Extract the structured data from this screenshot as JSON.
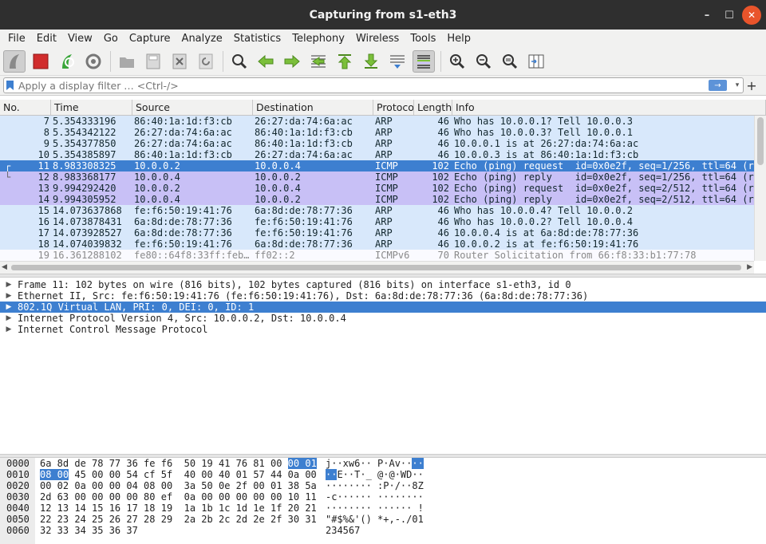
{
  "window": {
    "title": "Capturing from s1-eth3",
    "minimize": "–",
    "maximize": "☐",
    "close": "✕"
  },
  "menu": [
    "File",
    "Edit",
    "View",
    "Go",
    "Capture",
    "Analyze",
    "Statistics",
    "Telephony",
    "Wireless",
    "Tools",
    "Help"
  ],
  "filter": {
    "placeholder": "Apply a display filter … <Ctrl-/>",
    "apply_icon": "→",
    "dropdown_icon": "▾",
    "add_icon": "+"
  },
  "columns": [
    "No.",
    "Time",
    "Source",
    "Destination",
    "Protocol",
    "Length",
    "Info"
  ],
  "packets": [
    {
      "no": "7",
      "time": "5.354333196",
      "src": "86:40:1a:1d:f3:cb",
      "dst": "26:27:da:74:6a:ac",
      "proto": "ARP",
      "len": "46",
      "info": "Who has 10.0.0.1? Tell 10.0.0.3",
      "bg": "#d8e8fb",
      "fg": "#12272e"
    },
    {
      "no": "8",
      "time": "5.354342122",
      "src": "26:27:da:74:6a:ac",
      "dst": "86:40:1a:1d:f3:cb",
      "proto": "ARP",
      "len": "46",
      "info": "Who has 10.0.0.3? Tell 10.0.0.1",
      "bg": "#d8e8fb",
      "fg": "#12272e"
    },
    {
      "no": "9",
      "time": "5.354377850",
      "src": "26:27:da:74:6a:ac",
      "dst": "86:40:1a:1d:f3:cb",
      "proto": "ARP",
      "len": "46",
      "info": "10.0.0.1 is at 26:27:da:74:6a:ac",
      "bg": "#d8e8fb",
      "fg": "#12272e"
    },
    {
      "no": "10",
      "time": "5.354385897",
      "src": "86:40:1a:1d:f3:cb",
      "dst": "26:27:da:74:6a:ac",
      "proto": "ARP",
      "len": "46",
      "info": "10.0.0.3 is at 86:40:1a:1d:f3:cb",
      "bg": "#d8e8fb",
      "fg": "#12272e"
    },
    {
      "no": "11",
      "time": "8.983308325",
      "src": "10.0.0.2",
      "dst": "10.0.0.4",
      "proto": "ICMP",
      "len": "102",
      "info": "Echo (ping) request  id=0x0e2f, seq=1/256, ttl=64 (r",
      "bg": "#3d7fd0",
      "fg": "#ffffff",
      "selected": true,
      "mark": "┌"
    },
    {
      "no": "12",
      "time": "8.983368177",
      "src": "10.0.0.4",
      "dst": "10.0.0.2",
      "proto": "ICMP",
      "len": "102",
      "info": "Echo (ping) reply    id=0x0e2f, seq=1/256, ttl=64 (r",
      "bg": "#c8c0f6",
      "fg": "#12272e",
      "mark": "└"
    },
    {
      "no": "13",
      "time": "9.994292420",
      "src": "10.0.0.2",
      "dst": "10.0.0.4",
      "proto": "ICMP",
      "len": "102",
      "info": "Echo (ping) request  id=0x0e2f, seq=2/512, ttl=64 (r",
      "bg": "#c8c0f6",
      "fg": "#12272e"
    },
    {
      "no": "14",
      "time": "9.994305952",
      "src": "10.0.0.4",
      "dst": "10.0.0.2",
      "proto": "ICMP",
      "len": "102",
      "info": "Echo (ping) reply    id=0x0e2f, seq=2/512, ttl=64 (r",
      "bg": "#c8c0f6",
      "fg": "#12272e"
    },
    {
      "no": "15",
      "time": "14.073637868",
      "src": "fe:f6:50:19:41:76",
      "dst": "6a:8d:de:78:77:36",
      "proto": "ARP",
      "len": "46",
      "info": "Who has 10.0.0.4? Tell 10.0.0.2",
      "bg": "#d8e8fb",
      "fg": "#12272e"
    },
    {
      "no": "16",
      "time": "14.073878431",
      "src": "6a:8d:de:78:77:36",
      "dst": "fe:f6:50:19:41:76",
      "proto": "ARP",
      "len": "46",
      "info": "Who has 10.0.0.2? Tell 10.0.0.4",
      "bg": "#d8e8fb",
      "fg": "#12272e"
    },
    {
      "no": "17",
      "time": "14.073928527",
      "src": "6a:8d:de:78:77:36",
      "dst": "fe:f6:50:19:41:76",
      "proto": "ARP",
      "len": "46",
      "info": "10.0.0.4 is at 6a:8d:de:78:77:36",
      "bg": "#d8e8fb",
      "fg": "#12272e"
    },
    {
      "no": "18",
      "time": "14.074039832",
      "src": "fe:f6:50:19:41:76",
      "dst": "6a:8d:de:78:77:36",
      "proto": "ARP",
      "len": "46",
      "info": "10.0.0.2 is at fe:f6:50:19:41:76",
      "bg": "#d8e8fb",
      "fg": "#12272e"
    },
    {
      "no": "19",
      "time": "16.361288102",
      "src": "fe80::64f8:33ff:feb…",
      "dst": "ff02::2",
      "proto": "ICMPv6",
      "len": "70",
      "info": "Router Solicitation from 66:f8:33:b1:77:78",
      "bg": "#fafaff",
      "fg": "#8a8a8a"
    }
  ],
  "details": [
    {
      "text": "Frame 11: 102 bytes on wire (816 bits), 102 bytes captured (816 bits) on interface s1-eth3, id 0",
      "selected": false
    },
    {
      "text": "Ethernet II, Src: fe:f6:50:19:41:76 (fe:f6:50:19:41:76), Dst: 6a:8d:de:78:77:36 (6a:8d:de:78:77:36)",
      "selected": false
    },
    {
      "text": "802.1Q Virtual LAN, PRI: 0, DEI: 0, ID: 1",
      "selected": true
    },
    {
      "text": "Internet Protocol Version 4, Src: 10.0.0.2, Dst: 10.0.0.4",
      "selected": false
    },
    {
      "text": "Internet Control Message Protocol",
      "selected": false
    }
  ],
  "bytes": [
    {
      "offset": "0000",
      "hex_pre": "6a 8d de 78 77 36 fe f6  50 19 41 76 81 00 ",
      "hex_hl": "00 01",
      "hex_post": "",
      "ascii_pre": "j··xw6·· P·Av··",
      "ascii_hl": "··",
      "ascii_post": ""
    },
    {
      "offset": "0010",
      "hex_pre": "",
      "hex_hl": "08 00",
      "hex_post": " 45 00 00 54 cf 5f  40 00 40 01 57 44 0a 00",
      "ascii_pre": "",
      "ascii_hl": "··",
      "ascii_post": "E··T·_ @·@·WD··"
    },
    {
      "offset": "0020",
      "hex_pre": "00 02 0a 00 00 04 08 00  3a 50 0e 2f 00 01 38 5a",
      "hex_hl": "",
      "hex_post": "",
      "ascii_pre": "········ :P·/··8Z",
      "ascii_hl": "",
      "ascii_post": ""
    },
    {
      "offset": "0030",
      "hex_pre": "2d 63 00 00 00 00 80 ef  0a 00 00 00 00 00 10 11",
      "hex_hl": "",
      "hex_post": "",
      "ascii_pre": "-c······ ········",
      "ascii_hl": "",
      "ascii_post": ""
    },
    {
      "offset": "0040",
      "hex_pre": "12 13 14 15 16 17 18 19  1a 1b 1c 1d 1e 1f 20 21",
      "hex_hl": "",
      "hex_post": "",
      "ascii_pre": "········ ······ !",
      "ascii_hl": "",
      "ascii_post": ""
    },
    {
      "offset": "0050",
      "hex_pre": "22 23 24 25 26 27 28 29  2a 2b 2c 2d 2e 2f 30 31",
      "hex_hl": "",
      "hex_post": "",
      "ascii_pre": "\"#$%&'() *+,-./01",
      "ascii_hl": "",
      "ascii_post": ""
    },
    {
      "offset": "0060",
      "hex_pre": "32 33 34 35 36 37",
      "hex_hl": "",
      "hex_post": "",
      "ascii_pre": "234567",
      "ascii_hl": "",
      "ascii_post": ""
    }
  ],
  "colors": {
    "selected": "#3d7fd0",
    "arp": "#d8e8fb",
    "icmp": "#c8c0f6"
  }
}
